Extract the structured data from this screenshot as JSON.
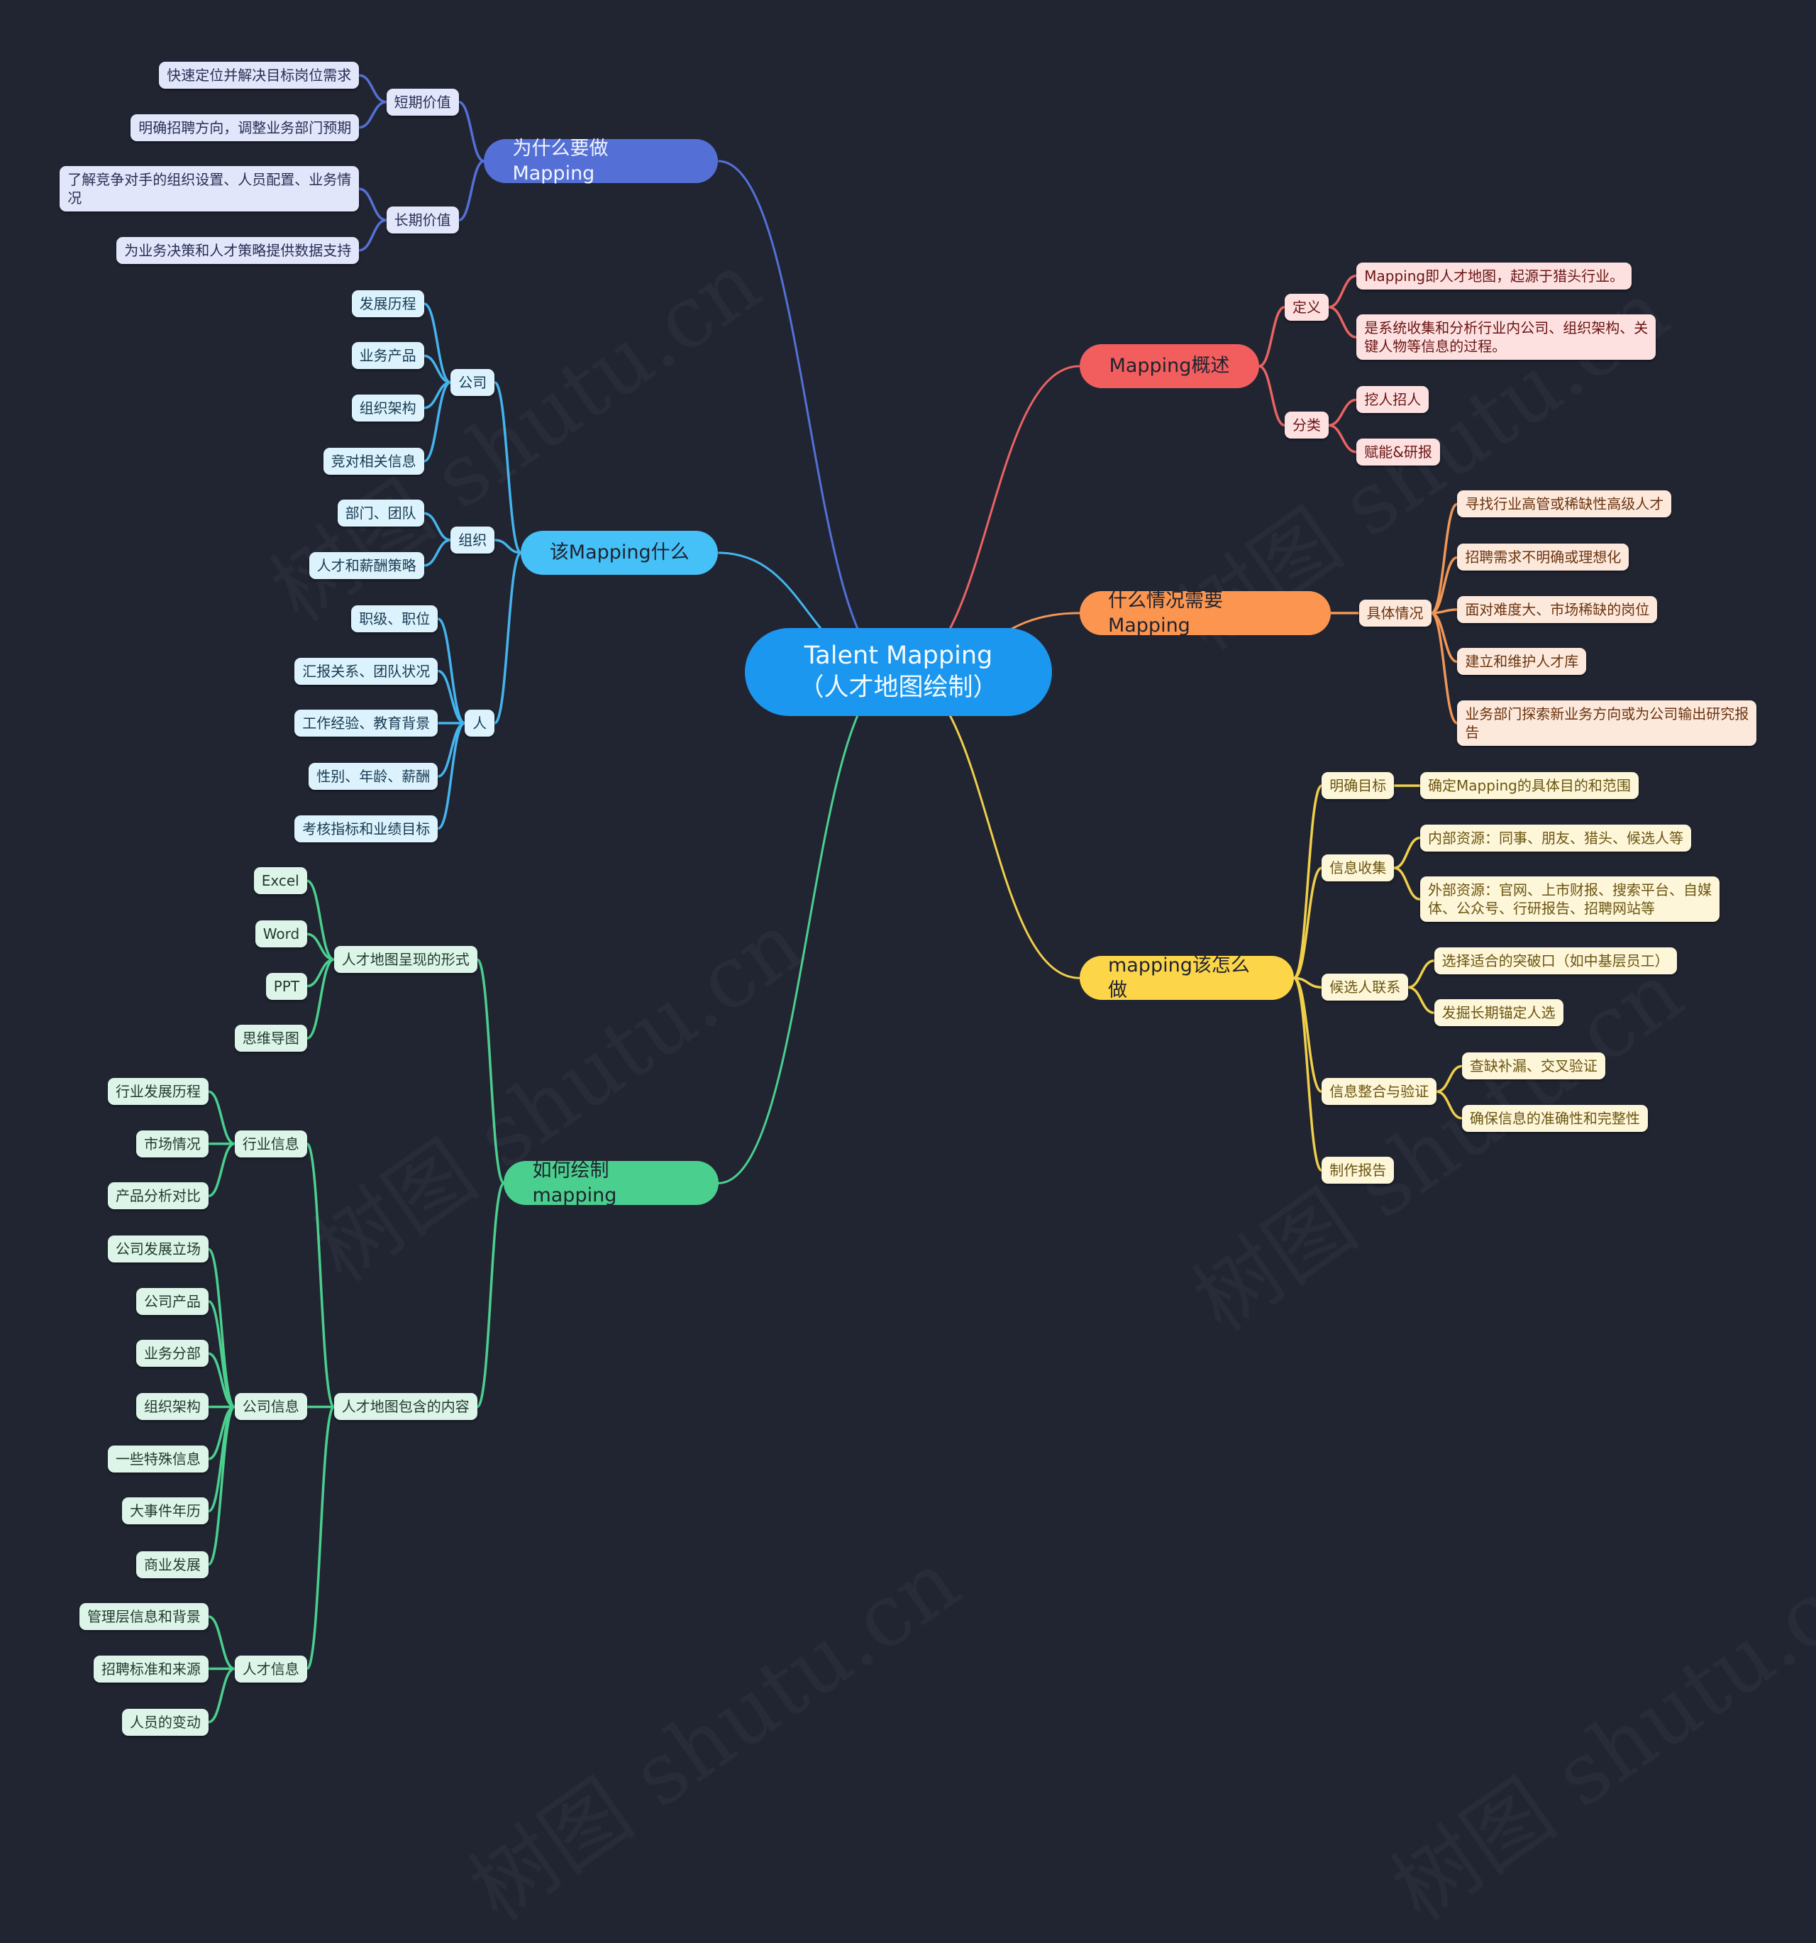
{
  "root": {
    "text": "Talent Mapping\n（人才地图绘制）"
  },
  "watermark_text": "树图 shutu.cn",
  "colors": {
    "background": "#212532",
    "root": "#1b97f0",
    "why": {
      "main": "#5470d6",
      "light": "#e1e6fa",
      "text": "#2a2f55",
      "line": "#5470d6"
    },
    "what": {
      "main": "#45c1f7",
      "light": "#dcf3fd",
      "text": "#183a52",
      "line": "#45b4ee"
    },
    "how_draw": {
      "main": "#4bcf8e",
      "light": "#ddf5e8",
      "text": "#1f3a2c",
      "line": "#4bcf8e"
    },
    "overview": {
      "main": "#f25d5d",
      "light": "#fde1e1",
      "text": "#6b1414",
      "line": "#e96363"
    },
    "when": {
      "main": "#fb9550",
      "light": "#fde9dc",
      "text": "#6b3410",
      "line": "#f09656"
    },
    "how_do": {
      "main": "#fcd549",
      "light": "#fdf6d9",
      "text": "#6b5510",
      "line": "#f0cf4a"
    }
  },
  "branches": {
    "why": {
      "label": "为什么要做Mapping",
      "children": [
        {
          "label": "短期价值",
          "children": [
            {
              "label": "快速定位并解决目标岗位需求"
            },
            {
              "label": "明确招聘方向，调整业务部门预期"
            }
          ]
        },
        {
          "label": "长期价值",
          "children": [
            {
              "label": "了解竞争对手的组织设置、人员配置、业务情\n况"
            },
            {
              "label": "为业务决策和人才策略提供数据支持"
            }
          ]
        }
      ]
    },
    "what": {
      "label": "该Mapping什么",
      "children": [
        {
          "label": "公司",
          "children": [
            {
              "label": "发展历程"
            },
            {
              "label": "业务产品"
            },
            {
              "label": "组织架构"
            },
            {
              "label": "竞对相关信息"
            }
          ]
        },
        {
          "label": "组织",
          "children": [
            {
              "label": "部门、团队"
            },
            {
              "label": "人才和薪酬策略"
            }
          ]
        },
        {
          "label": "人",
          "children": [
            {
              "label": "职级、职位"
            },
            {
              "label": "汇报关系、团队状况"
            },
            {
              "label": "工作经验、教育背景"
            },
            {
              "label": "性别、年龄、薪酬"
            },
            {
              "label": "考核指标和业绩目标"
            }
          ]
        }
      ]
    },
    "how_draw": {
      "label": "如何绘制mapping",
      "children": [
        {
          "label": "人才地图呈现的形式",
          "children": [
            {
              "label": "Excel"
            },
            {
              "label": "Word"
            },
            {
              "label": "PPT"
            },
            {
              "label": "思维导图"
            }
          ]
        },
        {
          "label": "人才地图包含的内容",
          "children": [
            {
              "label": "行业信息",
              "children": [
                {
                  "label": "行业发展历程"
                },
                {
                  "label": "市场情况"
                },
                {
                  "label": "产品分析对比"
                }
              ]
            },
            {
              "label": "公司信息",
              "children": [
                {
                  "label": "公司发展立场"
                },
                {
                  "label": "公司产品"
                },
                {
                  "label": "业务分部"
                },
                {
                  "label": "组织架构"
                },
                {
                  "label": "一些特殊信息"
                },
                {
                  "label": "大事件年历"
                },
                {
                  "label": "商业发展"
                }
              ]
            },
            {
              "label": "人才信息",
              "children": [
                {
                  "label": "管理层信息和背景"
                },
                {
                  "label": "招聘标准和来源"
                },
                {
                  "label": "人员的变动"
                }
              ]
            }
          ]
        }
      ]
    },
    "overview": {
      "label": "Mapping概述",
      "children": [
        {
          "label": "定义",
          "children": [
            {
              "label": "Mapping即人才地图，起源于猎头行业。"
            },
            {
              "label": "是系统收集和分析行业内公司、组织架构、关\n键人物等信息的过程。"
            }
          ]
        },
        {
          "label": "分类",
          "children": [
            {
              "label": "挖人招人"
            },
            {
              "label": "赋能&研报"
            }
          ]
        }
      ]
    },
    "when": {
      "label": "什么情况需要Mapping",
      "children": [
        {
          "label": "具体情况",
          "children": [
            {
              "label": "寻找行业高管或稀缺性高级人才"
            },
            {
              "label": "招聘需求不明确或理想化"
            },
            {
              "label": "面对难度大、市场稀缺的岗位"
            },
            {
              "label": "建立和维护人才库"
            },
            {
              "label": "业务部门探索新业务方向或为公司输出研究报\n告"
            }
          ]
        }
      ]
    },
    "how_do": {
      "label": "mapping该怎么做",
      "children": [
        {
          "label": "明确目标",
          "children": [
            {
              "label": "确定Mapping的具体目的和范围"
            }
          ]
        },
        {
          "label": "信息收集",
          "children": [
            {
              "label": "内部资源：同事、朋友、猎头、候选人等"
            },
            {
              "label": "外部资源：官网、上市财报、搜索平台、自媒\n体、公众号、行研报告、招聘网站等"
            }
          ]
        },
        {
          "label": "候选人联系",
          "children": [
            {
              "label": "选择适合的突破口（如中基层员工）"
            },
            {
              "label": "发掘长期锚定人选"
            }
          ]
        },
        {
          "label": "信息整合与验证",
          "children": [
            {
              "label": "查缺补漏、交叉验证"
            },
            {
              "label": "确保信息的准确性和完整性"
            }
          ]
        },
        {
          "label": "制作报告"
        }
      ]
    }
  }
}
